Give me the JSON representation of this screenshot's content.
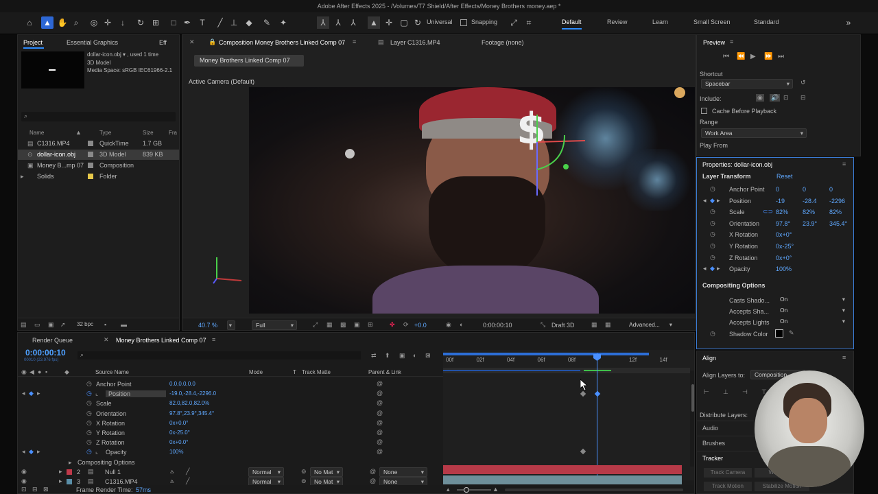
{
  "window_title": "Adobe After Effects 2025 - /Volumes/T7 Shield/After Effects/Money Brothers money.aep *",
  "toolbar": {
    "universal_label": "Universal",
    "snapping_label": "Snapping",
    "workspaces": [
      "Default",
      "Review",
      "Learn",
      "Small Screen",
      "Standard"
    ],
    "active_workspace": "Default"
  },
  "project_panel": {
    "tab_project": "Project",
    "tab_essential": "Essential Graphics",
    "tab_effects": "Eff",
    "info_name": "dollar-icon.obj ▾ , used 1 time",
    "info_type": "3D Model",
    "info_media": "Media Space: sRGB IEC61966-2.1",
    "search_placeholder": "",
    "columns": {
      "name": "Name",
      "type": "Type",
      "size": "Size",
      "frame": "Fra"
    },
    "items": [
      {
        "name": "C1316.MP4",
        "type": "QuickTime",
        "size": "1.7 GB",
        "color": "#8a8a8a"
      },
      {
        "name": "dollar-icon.obj",
        "type": "3D Model",
        "size": "839 KB",
        "color": "#8a8a8a"
      },
      {
        "name": "Money B...mp 07",
        "type": "Composition",
        "size": "",
        "color": "#8a8a8a"
      },
      {
        "name": "Solids",
        "type": "Folder",
        "size": "",
        "color": "#e6c84a"
      }
    ],
    "bpc": "32 bpc"
  },
  "viewer": {
    "comp_tab": "Composition Money Brothers Linked Comp 07",
    "layer_tab": "Layer C1316.MP4",
    "footage_tab": "Footage (none)",
    "breadcrumb": "Money Brothers Linked Comp 07",
    "camera_label": "Active Camera (Default)",
    "zoom": "40.7 %",
    "resolution": "Full",
    "exposure": "+0.0",
    "timecode": "0:00:00:10",
    "renderer": "Draft 3D",
    "advanced": "Advanced..."
  },
  "preview": {
    "title": "Preview",
    "shortcut_label": "Shortcut",
    "shortcut_value": "Spacebar",
    "include_label": "Include:",
    "cache_label": "Cache Before Playback",
    "range_label": "Range",
    "range_value": "Work Area",
    "play_from_label": "Play From"
  },
  "properties": {
    "title": "Properties: dollar-icon.obj",
    "section": "Layer Transform",
    "reset": "Reset",
    "rows": [
      {
        "label": "Anchor Point",
        "v1": "0",
        "v2": "0",
        "v3": "0"
      },
      {
        "label": "Position",
        "v1": "-19",
        "v2": "-28.4",
        "v3": "-2296"
      },
      {
        "label": "Scale",
        "v1": "82%",
        "v2": "82%",
        "v3": "82%"
      },
      {
        "label": "Orientation",
        "v1": "97.8°",
        "v2": "23.9°",
        "v3": "345.4°"
      },
      {
        "label": "X Rotation",
        "v1": "0x+0°",
        "v2": "",
        "v3": ""
      },
      {
        "label": "Y Rotation",
        "v1": "0x-25°",
        "v2": "",
        "v3": ""
      },
      {
        "label": "Z Rotation",
        "v1": "0x+0°",
        "v2": "",
        "v3": ""
      },
      {
        "label": "Opacity",
        "v1": "100%",
        "v2": "",
        "v3": ""
      }
    ],
    "compositing_title": "Compositing Options",
    "casts_shadows": "Casts Shado...",
    "casts_value": "On",
    "accepts_shadows": "Accepts Sha...",
    "accepts_shadows_value": "On",
    "accepts_lights": "Accepts Lights",
    "accepts_lights_value": "On",
    "shadow_color": "Shadow Color"
  },
  "align": {
    "title": "Align",
    "align_to_label": "Align Layers to:",
    "align_to_value": "Composition",
    "distribute": "Distribute Layers:",
    "audio": "Audio",
    "brushes": "Brushes",
    "tracker": "Tracker",
    "track_camera": "Track Camera",
    "warp": "Warp",
    "track_motion": "Track Motion",
    "stabilize": "Stabilize Motion"
  },
  "timeline": {
    "render_queue_tab": "Render Queue",
    "comp_tab": "Money Brothers Linked Comp 07",
    "timecode": "0:00:00:10",
    "fps": "00010 (23.976 fps)",
    "headers": {
      "source": "Source Name",
      "mode": "Mode",
      "t": "T",
      "matte": "Track Matte",
      "parent": "Parent & Link"
    },
    "ruler": [
      "00f",
      "02f",
      "04f",
      "06f",
      "08f",
      "",
      "12f",
      "14f"
    ],
    "props": [
      {
        "label": "Anchor Point",
        "value": "0.0,0.0,0.0"
      },
      {
        "label": "Position",
        "value": "-19.0,-28.4,-2296.0"
      },
      {
        "label": "Scale",
        "value": "82.0,82.0,82.0%"
      },
      {
        "label": "Orientation",
        "value": "97.8°,23.9°,345.4°"
      },
      {
        "label": "X Rotation",
        "value": "0x+0.0°"
      },
      {
        "label": "Y Rotation",
        "value": "0x-25.0°"
      },
      {
        "label": "Z Rotation",
        "value": "0x+0.0°"
      },
      {
        "label": "Opacity",
        "value": "100%"
      }
    ],
    "compositing": "Compositing Options",
    "layers": [
      {
        "num": "2",
        "name": "Null 1",
        "mode": "Normal",
        "matte": "No Mat",
        "parent": "None",
        "color": "#c0394a"
      },
      {
        "num": "3",
        "name": "C1316.MP4",
        "mode": "Normal",
        "matte": "No Mat",
        "parent": "None",
        "color": "#5a8fa8"
      }
    ],
    "frame_render_label": "Frame Render Time:",
    "frame_render_value": "57ms"
  },
  "colors": {
    "accent": "#2d8cff",
    "panel": "#1d1d1d"
  }
}
